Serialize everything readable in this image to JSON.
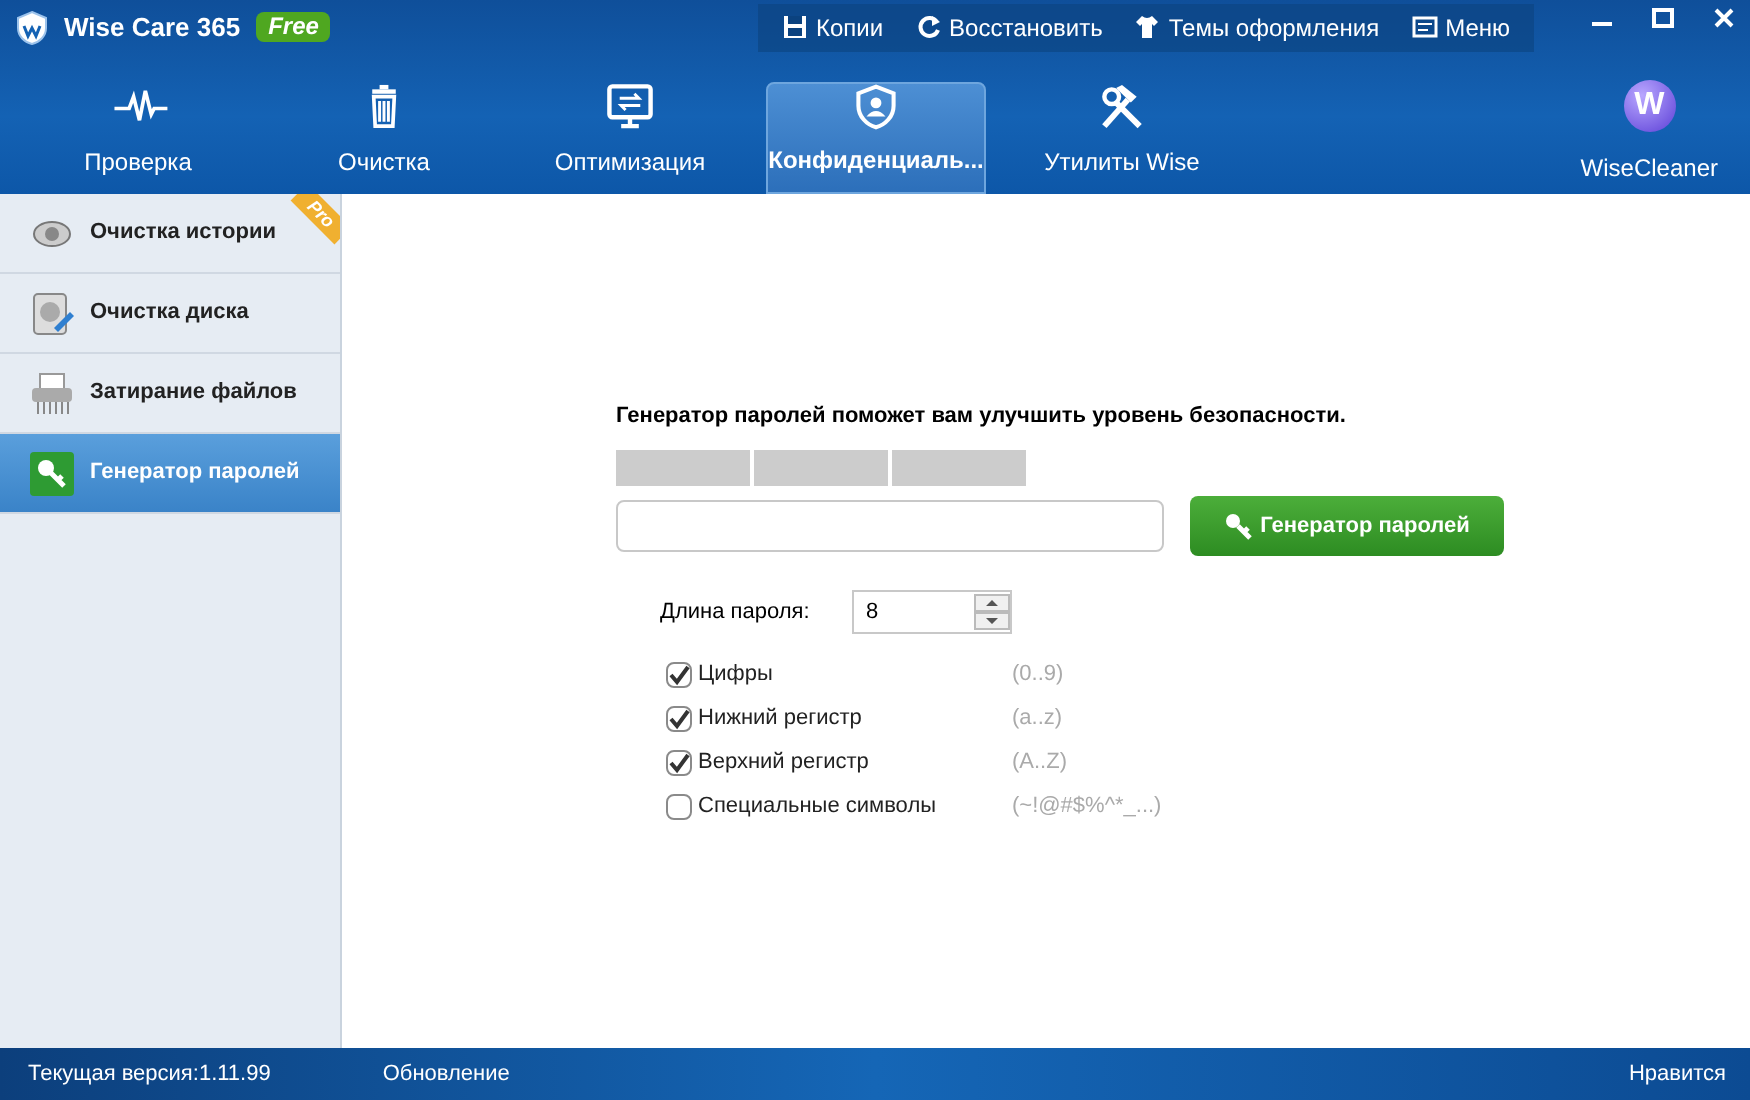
{
  "window": {
    "title": "Wise Care 365",
    "edition_badge": "Free"
  },
  "top_menu": [
    {
      "kind": "save",
      "label": "Копии"
    },
    {
      "kind": "restore",
      "label": "Восстановить"
    },
    {
      "kind": "shirt",
      "label": "Темы оформления"
    },
    {
      "kind": "menu",
      "label": "Меню"
    }
  ],
  "nav_tabs": [
    {
      "kind": "pulse",
      "label": "Проверка",
      "selected": false
    },
    {
      "kind": "trash",
      "label": "Очистка",
      "selected": false
    },
    {
      "kind": "monitor",
      "label": "Оптимизация",
      "selected": false
    },
    {
      "kind": "shield",
      "label": "Конфиденциаль...",
      "selected": true
    },
    {
      "kind": "tools",
      "label": "Утилиты Wise",
      "selected": false
    }
  ],
  "brand": {
    "logo_letter": "W",
    "label": "WiseCleaner"
  },
  "sidebar": {
    "items": [
      {
        "kind": "eye",
        "label": "Очистка истории",
        "selected": false,
        "pro": "Pro"
      },
      {
        "kind": "disk",
        "label": "Очистка диска",
        "selected": false
      },
      {
        "kind": "shredder",
        "label": "Затирание файлов",
        "selected": false
      },
      {
        "kind": "key",
        "label": "Генератор паролей",
        "selected": true
      }
    ]
  },
  "content": {
    "heading": "Генератор паролей поможет вам улучшить уровень безопасности.",
    "generate_button": "Генератор паролей",
    "length_label": "Длина пароля:",
    "length_value": "8",
    "options": [
      {
        "label": "Цифры",
        "range": "(0..9)",
        "checked": true
      },
      {
        "label": "Нижний регистр",
        "range": "(a..z)",
        "checked": true
      },
      {
        "label": "Верхний регистр",
        "range": "(A..Z)",
        "checked": true
      },
      {
        "label": "Специальные символы",
        "range": "(~!@#$%^*_...)",
        "checked": false
      }
    ]
  },
  "status_bar": {
    "version": "Текущая версия:1.11.99",
    "update": "Обновление",
    "like": "Нравится"
  }
}
